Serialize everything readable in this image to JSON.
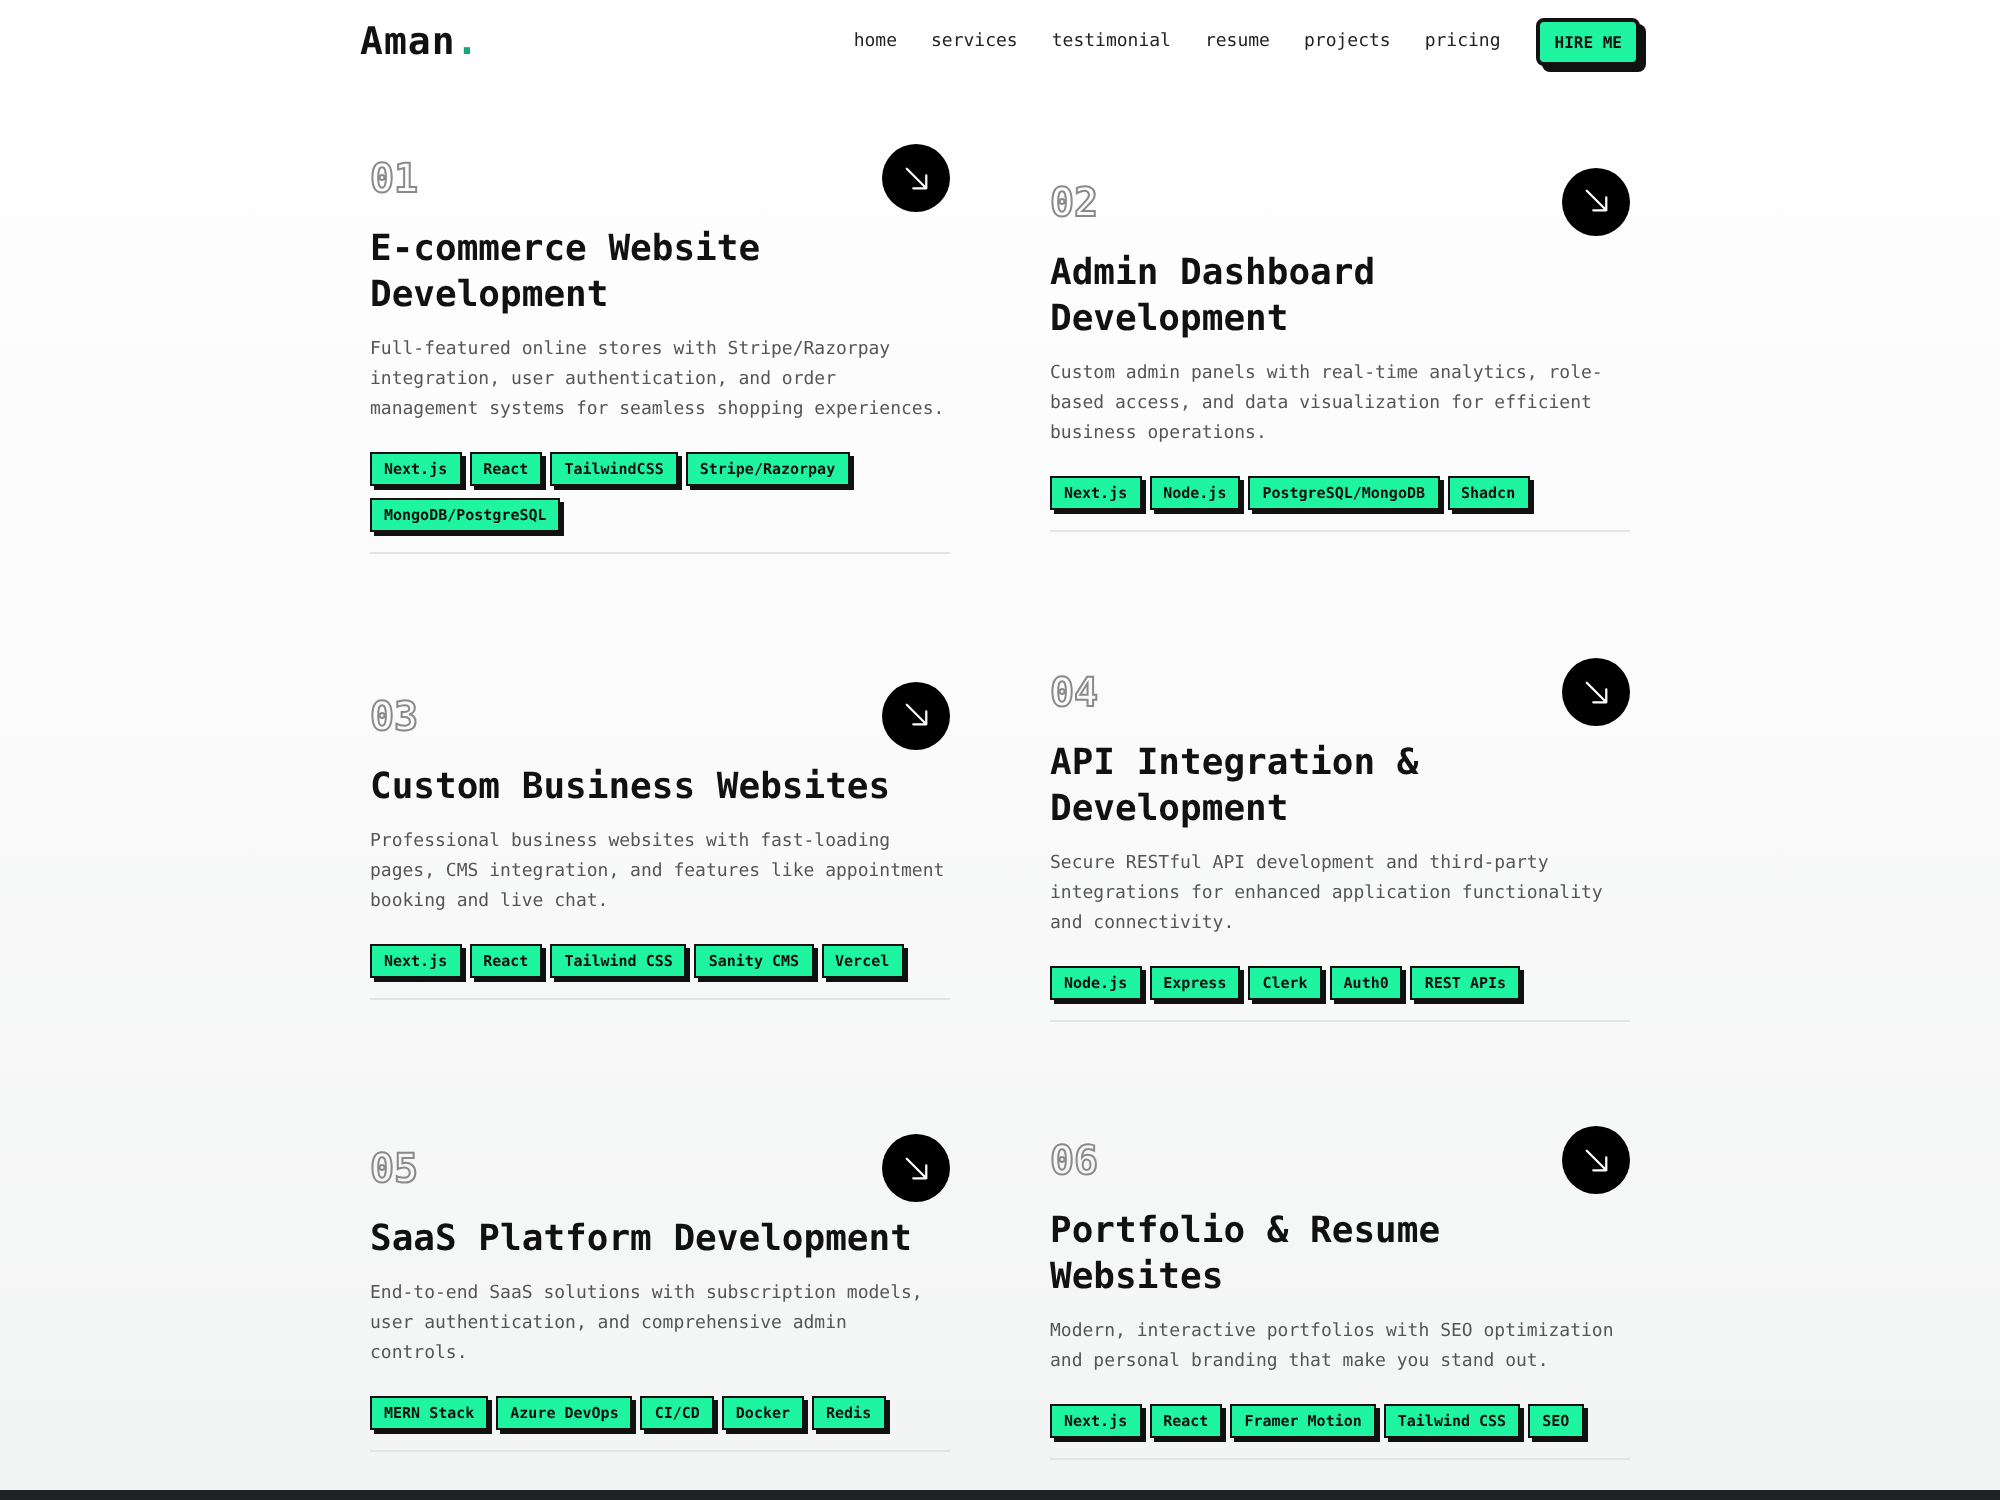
{
  "header": {
    "logo": {
      "text": "Aman",
      "dot": "."
    },
    "nav": [
      "home",
      "services",
      "testimonial",
      "resume",
      "projects",
      "pricing"
    ],
    "cta": "HIRE ME"
  },
  "columns": [
    {
      "services": [
        {
          "number": "01",
          "title": "E-commerce Website Development",
          "description": "Full-featured online stores with Stripe/Razorpay integration, user authentication, and order management systems for seamless shopping experiences.",
          "tags": [
            "Next.js",
            "React",
            "TailwindCSS",
            "Stripe/Razorpay",
            "MongoDB/PostgreSQL"
          ]
        },
        {
          "number": "03",
          "title": "Custom Business Websites",
          "description": "Professional business websites with fast-loading pages, CMS integration, and features like appointment booking and live chat.",
          "tags": [
            "Next.js",
            "React",
            "Tailwind CSS",
            "Sanity CMS",
            "Vercel"
          ]
        },
        {
          "number": "05",
          "title": "SaaS Platform Development",
          "description": "End-to-end SaaS solutions with subscription models, user authentication, and comprehensive admin controls.",
          "tags": [
            "MERN Stack",
            "Azure DevOps",
            "CI/CD",
            "Docker",
            "Redis"
          ]
        }
      ]
    },
    {
      "services": [
        {
          "number": "02",
          "title": "Admin Dashboard Development",
          "description": "Custom admin panels with real-time analytics, role-based access, and data visualization for efficient business operations.",
          "tags": [
            "Next.js",
            "Node.js",
            "PostgreSQL/MongoDB",
            "Shadcn"
          ]
        },
        {
          "number": "04",
          "title": "API Integration & Development",
          "description": "Secure RESTful API development and third-party integrations for enhanced application functionality and connectivity.",
          "tags": [
            "Node.js",
            "Express",
            "Clerk",
            "Auth0",
            "REST APIs"
          ]
        },
        {
          "number": "06",
          "title": "Portfolio & Resume Websites",
          "description": "Modern, interactive portfolios with SEO optimization and personal branding that make you stand out.",
          "tags": [
            "Next.js",
            "React",
            "Framer Motion",
            "Tailwind CSS",
            "SEO"
          ]
        }
      ]
    }
  ]
}
